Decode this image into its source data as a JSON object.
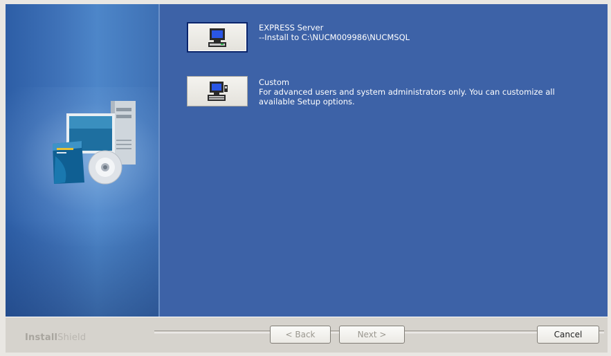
{
  "options": [
    {
      "title": "EXPRESS Server",
      "description": "--Install to C:\\NUCM009986\\NUCMSQL",
      "icon": "computer-icon"
    },
    {
      "title": "Custom",
      "description_line1": "For advanced users and system administrators only.  You can customize all",
      "description_line2": "available Setup options.",
      "icon": "computer-settings-icon"
    }
  ],
  "brand": {
    "bold": "Install",
    "light": "Shield"
  },
  "buttons": {
    "back": "< Back",
    "next": "Next >",
    "cancel": "Cancel"
  },
  "colors": {
    "main_panel": "#3d62a7",
    "side_panel": "#3f72b8",
    "text": "#ffffff"
  }
}
